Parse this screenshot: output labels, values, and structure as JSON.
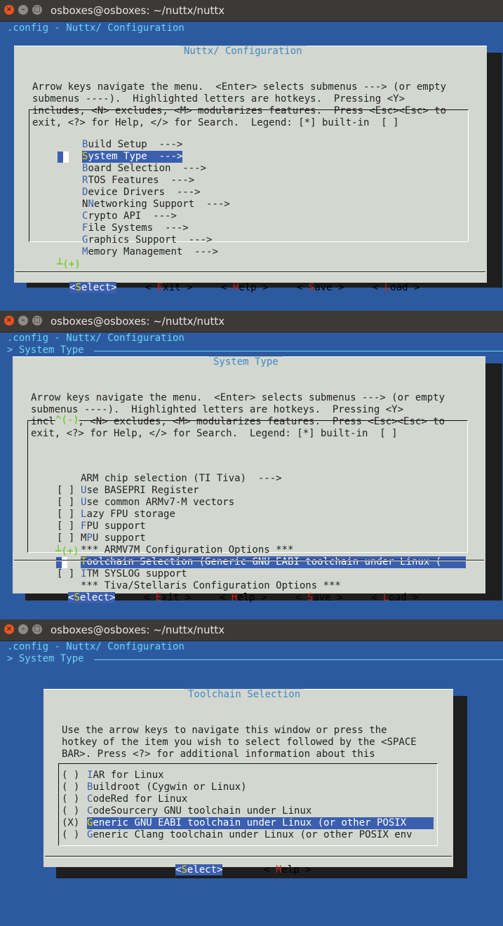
{
  "window_title": "osboxes@osboxes: ~/nuttx/nuttx",
  "config_line": ".config - Nuttx/ Configuration",
  "breadcrumb": "> System Type",
  "panel1": {
    "title": "Nuttx/ Configuration",
    "help": [
      "Arrow keys navigate the menu.  <Enter> selects submenus ---> (or empty",
      "submenus ----).  Highlighted letters are hotkeys.  Pressing <Y>",
      "includes, <N> excludes, <M> modularizes features.  Press <Esc><Esc> to",
      "exit, <?> for Help, </> for Search.  Legend: [*] built-in  [ ]"
    ],
    "items": [
      {
        "hk": "B",
        "rest": "uild Setup  --->"
      },
      {
        "hk": "S",
        "rest": "ystem Type  --->",
        "selected": true
      },
      {
        "hk": "B",
        "rest": "oard Selection  --->"
      },
      {
        "hk": "R",
        "rest": "TOS Features  --->"
      },
      {
        "hk": "D",
        "rest": "evice Drivers  --->"
      },
      {
        "hk": "N",
        "rest": "etworking Support  --->",
        "pre": "N",
        "hkmid": "e"
      },
      {
        "hk": "C",
        "rest": "rypto API  --->"
      },
      {
        "hk": "F",
        "rest": "ile Systems  --->"
      },
      {
        "hk": "G",
        "rest": "raphics Support  --->"
      },
      {
        "hk": "M",
        "rest": "emory Management  --->"
      }
    ],
    "more_bottom": "┴(+)"
  },
  "panel2": {
    "title": "System Type",
    "help": [
      "Arrow keys navigate the menu.  <Enter> selects submenus ---> (or empty",
      "submenus ----).  Highlighted letters are hotkeys.  Pressing <Y>",
      "includes, <N> excludes, <M> modularizes features.  Press <Esc><Esc> to",
      "exit, <?> for Help, </> for Search.  Legend: [*] built-in  [ ]"
    ],
    "more_top": "^(-)",
    "items": [
      {
        "box": "   ",
        "hk": "",
        "rest": "ARM chip selection (TI Tiva)  --->"
      },
      {
        "box": "[ ]",
        "hk": "U",
        "rest": "se BASEPRI Register"
      },
      {
        "box": "[ ]",
        "hk": "U",
        "rest": "se common ARMv7-M vectors"
      },
      {
        "box": "[ ]",
        "hk": "L",
        "rest": "azy FPU storage"
      },
      {
        "box": "[ ]",
        "hk": "F",
        "rest": "PU support"
      },
      {
        "box": "[ ]",
        "pre": "M",
        "hk": "P",
        "rest": "U support"
      },
      {
        "box": "   ",
        "hk": "",
        "rest": "*** ARMV7M Configuration Options ***"
      },
      {
        "box": "   ",
        "hk": "T",
        "rest": "oolchain Selection (Generic GNU EABI toolchain under Linux (",
        "selected": true
      },
      {
        "box": "[ ]",
        "hk": "I",
        "rest": "TM SYSLOG support"
      },
      {
        "box": "   ",
        "hk": "",
        "rest": "*** Tiva/Stellaris Configuration Options ***"
      }
    ],
    "more_bottom": "┴(+)"
  },
  "panel3": {
    "title": "Toolchain Selection",
    "help": [
      "Use the arrow keys to navigate this window or press the",
      "hotkey of the item you wish to select followed by the <SPACE",
      "BAR>. Press <?> for additional information about this"
    ],
    "items": [
      {
        "box": "( )",
        "hk": "I",
        "rest": "AR for Linux"
      },
      {
        "box": "( )",
        "hk": "B",
        "rest": "uildroot (Cygwin or Linux)"
      },
      {
        "box": "( )",
        "hk": "C",
        "rest": "odeRed for Linux"
      },
      {
        "box": "( )",
        "hk": "C",
        "rest": "odeSourcery GNU toolchain under Linux"
      },
      {
        "box": "(X)",
        "hk": "G",
        "rest": "eneric GNU EABI toolchain under Linux (or other POSIX",
        "selected": true
      },
      {
        "box": "( )",
        "hk": "G",
        "rest": "eneric Clang toolchain under Linux (or other POSIX env"
      }
    ]
  },
  "buttons": {
    "select": {
      "pre": "<",
      "hk": "S",
      "rest": "elect>"
    },
    "exit": {
      "pre": "< ",
      "hk": "E",
      "rest": "xit >"
    },
    "help": {
      "pre": "< ",
      "hk": "H",
      "rest": "elp >"
    },
    "save": {
      "pre": "< ",
      "hk": "S",
      "rest": "ave >"
    },
    "load": {
      "pre": "< ",
      "hk": "L",
      "rest": "oad >"
    }
  },
  "window_controls": {
    "close": "×",
    "minimize": "–",
    "maximize": "□"
  },
  "colors": {
    "background": "#2c5aa0",
    "dialog": "#d3d7cf",
    "highlight": "#3b5fae",
    "hotkey_red": "#c4201c",
    "title_blue": "#3f88c4",
    "header_cyan": "#6ed3f0"
  }
}
